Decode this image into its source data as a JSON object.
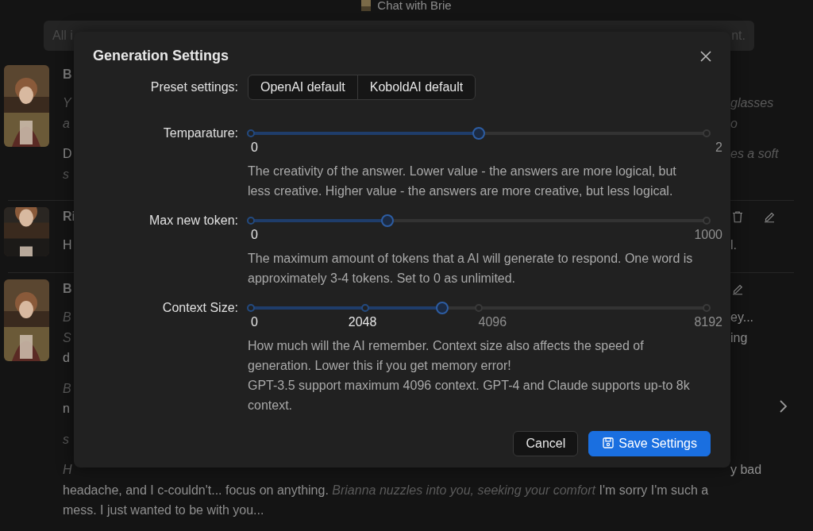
{
  "header": {
    "title": "Chat with Brie"
  },
  "notice": {
    "left": "All i",
    "right": "nt."
  },
  "messages": [
    {
      "name": "B",
      "paragraphs": [
        [
          {
            "left": {
              "text": "Y",
              "italic": true
            },
            "right": {
              "text": "glasses",
              "italic": true
            }
          },
          {
            "left": {
              "text": "a",
              "italic": true
            },
            "right": {
              "text": "o",
              "italic": true
            }
          }
        ],
        [
          {
            "left": {
              "text": "D",
              "italic": false
            },
            "right": {
              "text": "es a soft",
              "italic": true
            }
          },
          {
            "left": {
              "text": "s",
              "italic": true
            }
          }
        ]
      ]
    },
    {
      "name": "Ri",
      "actions": [
        {
          "kind": "delete"
        },
        {
          "kind": "edit"
        }
      ],
      "paragraphs": [
        [
          {
            "left": {
              "text": "H",
              "italic": false
            },
            "right": {
              "text": "l.",
              "italic": false
            }
          }
        ]
      ]
    },
    {
      "name": "B",
      "actions": [
        {
          "kind": "edit"
        }
      ],
      "paragraphs": [
        [
          {
            "left": {
              "text": "B",
              "italic": true
            },
            "right": {
              "text": "ey...",
              "italic": false
            }
          },
          {
            "left": {
              "text": "S",
              "italic": true
            },
            "right": {
              "text": "ing",
              "italic": false
            }
          },
          {
            "left": {
              "text": "d",
              "italic": false
            }
          }
        ],
        [
          {
            "left": {
              "text": "B",
              "italic": true
            }
          },
          {
            "left": {
              "text": "n",
              "italic": false
            }
          }
        ],
        [
          {
            "left": {
              "text": "s",
              "italic": true
            }
          }
        ],
        [
          {
            "left": {
              "text": "H",
              "italic": true
            },
            "right": {
              "text": "y bad",
              "italic": false
            }
          },
          {
            "full": "headache, and I c-couldn't... focus on anything. *Brianna nuzzles into you, seeking your comfort* I'm sorry I'm such a"
          },
          {
            "full": "mess. I just wanted to be with you..."
          }
        ]
      ]
    }
  ],
  "modal": {
    "title": "Generation Settings",
    "rows": [
      {
        "kind": "presets",
        "label": "Preset settings:",
        "options": [
          "OpenAI default",
          "KoboldAI default"
        ]
      },
      {
        "kind": "slider",
        "label": "Temparature:",
        "level": 0.5,
        "marks": [
          "0",
          "2"
        ],
        "description": [
          "The creativity of the answer. Lower value - the answers are more logical, but less creative. Higher value - the answers are more creative, but less logical."
        ]
      },
      {
        "kind": "slider",
        "label": "Max new token:",
        "level": 0.3,
        "marks": [
          "0",
          "1000"
        ],
        "description": [
          "The maximum amount of tokens that a AI will generate to respond. One word is approximately 3-4 tokens. Set to 0 as unlimited."
        ]
      },
      {
        "kind": "slider",
        "label": "Context Size:",
        "level": 0.42,
        "marks": [
          "0",
          "2048",
          "4096",
          "8192"
        ],
        "description": [
          "How much will the AI remember. Context size also affects the speed of generation. Lower this if you get memory error!",
          "GPT-3.5 support maximum 4096 context. GPT-4 and Claude supports up-to 8k context."
        ]
      }
    ],
    "buttons": [
      {
        "kind": "secondary",
        "label": "Cancel"
      },
      {
        "kind": "primary",
        "label": "Save Settings"
      }
    ]
  }
}
